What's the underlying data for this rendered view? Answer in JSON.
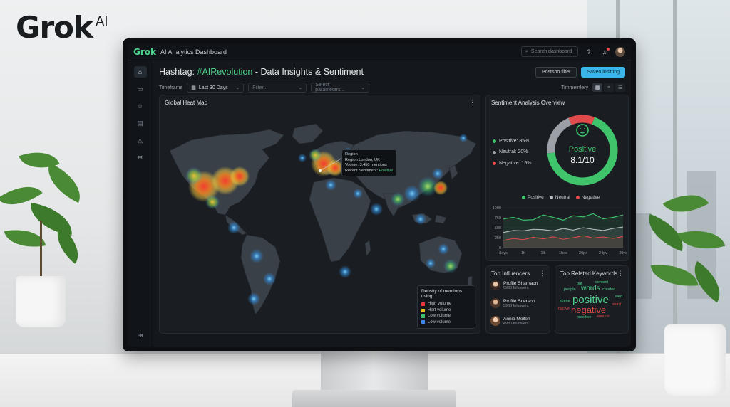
{
  "brand": {
    "name": "Grok",
    "suffix": "AI"
  },
  "app": {
    "logo": "Grok",
    "title": "AI Analytics Dashboard",
    "search_placeholder": "Search dashboard"
  },
  "sidebar": {
    "items": [
      "home-icon",
      "folder-icon",
      "users-icon",
      "document-icon",
      "alert-icon",
      "settings-icon"
    ],
    "bottom": "logout-icon"
  },
  "page": {
    "title_prefix": "Hashtag: ",
    "hashtag": "#AIRevolution",
    "title_suffix": " - Data Insights & Sentiment",
    "btn_filter": "Postsoo filter",
    "btn_save": "Saveo insitting"
  },
  "filters": {
    "timeframe_label": "Timeframe",
    "timeframe_value": "Last 30 Days",
    "filter_placeholder": "Filter...",
    "params_placeholder": "Select parameters...",
    "timeline_label": "Timmeinlery"
  },
  "map": {
    "title": "Global Heat Map",
    "tooltip": {
      "title": "Region",
      "region": "Region London, UK",
      "volume": "Voome: 3,450 mentions",
      "sentiment_label": "Recent Sentiment: ",
      "sentiment_value": "Positive"
    },
    "legend": {
      "title": "Density of mentions using",
      "items": [
        {
          "label": "High volume",
          "color": "#e53935"
        },
        {
          "label": "Hert volume",
          "color": "#f5b921"
        },
        {
          "label": "Low volume",
          "color": "#3fc46c"
        },
        {
          "label": "Low volume",
          "color": "#3a86e0"
        }
      ]
    }
  },
  "sentiment": {
    "title": "Sentiment Analysis Overview",
    "positive": "Positive: 85%",
    "neutral": "Neutral: 20%",
    "negative": "Negative: 15%",
    "center_label": "Positive",
    "score": "8.1/10",
    "colors": {
      "positive": "#3fc46c",
      "neutral": "#9aa0a6",
      "negative": "#e04a4a"
    },
    "donut": {
      "positive": 0.68,
      "neutral": 0.2,
      "negative": 0.12
    }
  },
  "chart_data": {
    "type": "area",
    "x": [
      "8ays",
      "1lt",
      "1lk",
      "1has",
      "20ps",
      "24pv",
      "30ys"
    ],
    "y_ticks": [
      "1000",
      "750",
      "500",
      "250",
      "0"
    ],
    "ylim": [
      0,
      1000
    ],
    "series": [
      {
        "name": "Positive",
        "color": "#3fc46c",
        "values": [
          720,
          760,
          690,
          700,
          820,
          760,
          690,
          800,
          770,
          850,
          720,
          760,
          820
        ]
      },
      {
        "name": "Neutral",
        "color": "#b9bec3",
        "values": [
          380,
          430,
          420,
          460,
          450,
          420,
          480,
          440,
          500,
          460,
          430,
          480,
          520
        ]
      },
      {
        "name": "Negative",
        "color": "#e04a4a",
        "values": [
          180,
          230,
          200,
          260,
          220,
          270,
          210,
          250,
          300,
          240,
          270,
          230,
          280
        ]
      }
    ]
  },
  "influencers": {
    "title": "Top Influencers",
    "items": [
      {
        "name": "Profile Sharnaon",
        "followers": "5930 followers"
      },
      {
        "name": "Profile Snerson",
        "followers": "3930 followers"
      },
      {
        "name": "Annia Mollen",
        "followers": "4930 followers"
      }
    ]
  },
  "keywords": {
    "title": "Top Related Keywords",
    "words": [
      {
        "text": "out",
        "color": "#4fd18b"
      },
      {
        "text": "sentent",
        "color": "#4fd18b"
      },
      {
        "text": "people",
        "color": "#4fd18b"
      },
      {
        "text": "words",
        "color": "#4fd18b"
      },
      {
        "text": "created",
        "color": "#4fd18b"
      },
      {
        "text": "scene",
        "color": "#4fd18b"
      },
      {
        "text": "positive",
        "color": "#4fd18b"
      },
      {
        "text": "wed",
        "color": "#4fd18b"
      },
      {
        "text": "nacive",
        "color": "#e04a4a"
      },
      {
        "text": "negative",
        "color": "#e04a4a"
      },
      {
        "text": "word",
        "color": "#e04a4a"
      },
      {
        "text": "precitive",
        "color": "#4fd18b"
      },
      {
        "text": "ennucs",
        "color": "#e04a4a"
      }
    ]
  }
}
